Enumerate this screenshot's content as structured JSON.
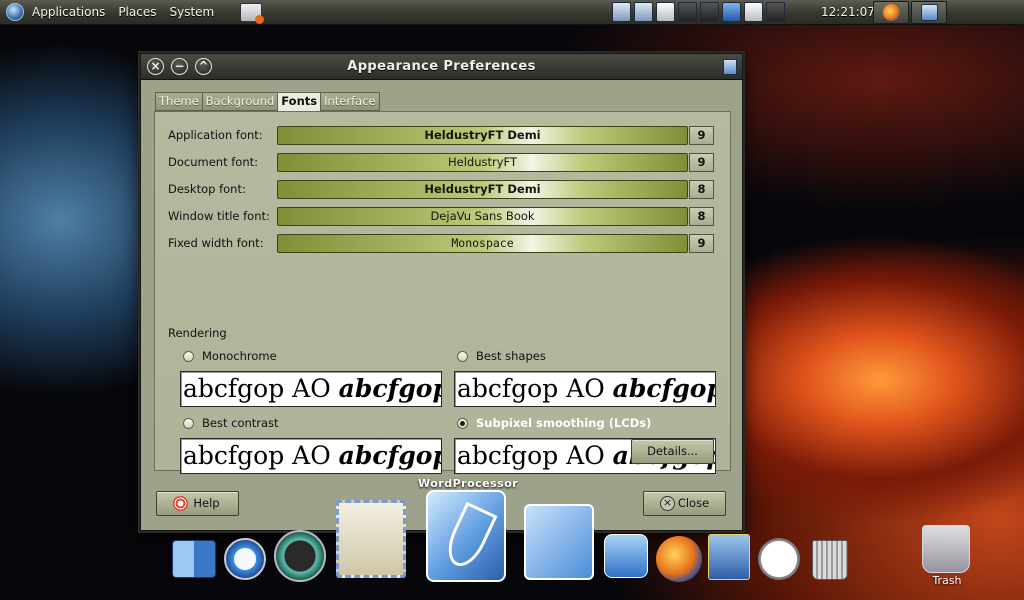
{
  "panel": {
    "menus": [
      "Applications",
      "Places",
      "System"
    ],
    "clock": "12:21:07"
  },
  "window": {
    "title": "Appearance Preferences",
    "tabs": [
      {
        "label": "Theme"
      },
      {
        "label": "Background"
      },
      {
        "label": "Fonts",
        "active": true
      },
      {
        "label": "Interface"
      }
    ],
    "fonts": [
      {
        "label": "Application font:",
        "value": "HeldustryFT Demi",
        "size": "9"
      },
      {
        "label": "Document font:",
        "value": "HeldustryFT",
        "size": "9"
      },
      {
        "label": "Desktop font:",
        "value": "HeldustryFT Demi",
        "size": "8"
      },
      {
        "label": "Window title font:",
        "value": "DejaVu Sans Book",
        "size": "8"
      },
      {
        "label": "Fixed width font:",
        "value": "Monospace",
        "size": "9"
      }
    ],
    "rendering": {
      "title": "Rendering",
      "options": [
        {
          "label": "Monochrome",
          "selected": false
        },
        {
          "label": "Best shapes",
          "selected": false
        },
        {
          "label": "Best contrast",
          "selected": false
        },
        {
          "label": "Subpixel smoothing (LCDs)",
          "selected": true
        }
      ],
      "sample_plain": "abcfgop AO ",
      "sample_italic": "abcfgop"
    },
    "details_label": "Details...",
    "help_label": "Help",
    "close_label": "Close"
  },
  "dock": {
    "hover_label": "WordProcessor",
    "trash_label": "Trash"
  }
}
